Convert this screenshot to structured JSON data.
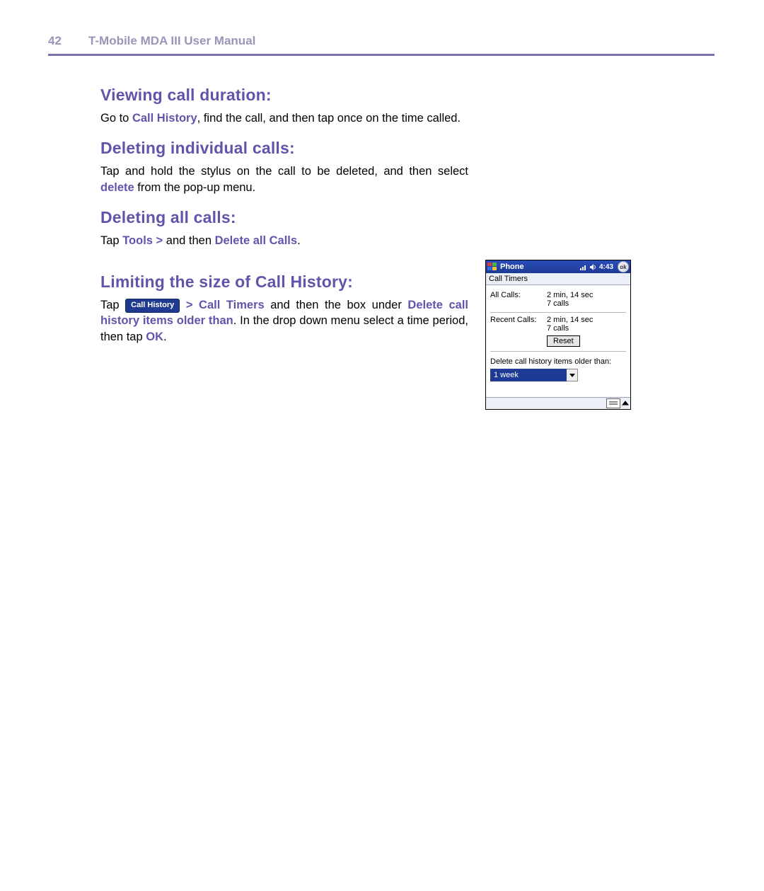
{
  "header": {
    "page_number": "42",
    "running_title": "T-Mobile MDA III User Manual"
  },
  "sections": {
    "s1": {
      "heading": "Viewing call duration:",
      "p1_pre": "Go to ",
      "p1_kw": "Call History",
      "p1_post": ", find the call, and then tap once on the time called."
    },
    "s2": {
      "heading": "Deleting individual calls:",
      "p1_pre": "Tap and hold the stylus on the call to be deleted, and then select ",
      "p1_kw": "delete",
      "p1_post": " from the pop-up menu."
    },
    "s3": {
      "heading": "Deleting all calls:",
      "p1_pre": "Tap ",
      "p1_kw1": "Tools >",
      "p1_mid": " and then ",
      "p1_kw2": "Delete all Calls",
      "p1_post": "."
    },
    "s4": {
      "heading": "Limiting the size of Call History:",
      "p1_pre": "Tap ",
      "chip": "Call History",
      "p1_kw1": " > Call Timers",
      "p1_mid1": " and then the box under ",
      "p1_kw2": " Delete call history items older than",
      "p1_mid2": ". In the drop down menu select a time period, then tap ",
      "p1_kw3": "OK",
      "p1_post": "."
    }
  },
  "screenshot": {
    "titlebar": {
      "app": "Phone",
      "clock": "4:43",
      "ok": "ok"
    },
    "subtitle": "Call Timers",
    "rows": {
      "all_calls": {
        "label": "All Calls:",
        "line1": "2 min, 14 sec",
        "line2": "7 calls"
      },
      "recent_calls": {
        "label": "Recent Calls:",
        "line1": "2 min, 14 sec",
        "line2": "7 calls",
        "reset": "Reset"
      }
    },
    "delete_label": "Delete call history items older than:",
    "dropdown_value": "1 week"
  }
}
